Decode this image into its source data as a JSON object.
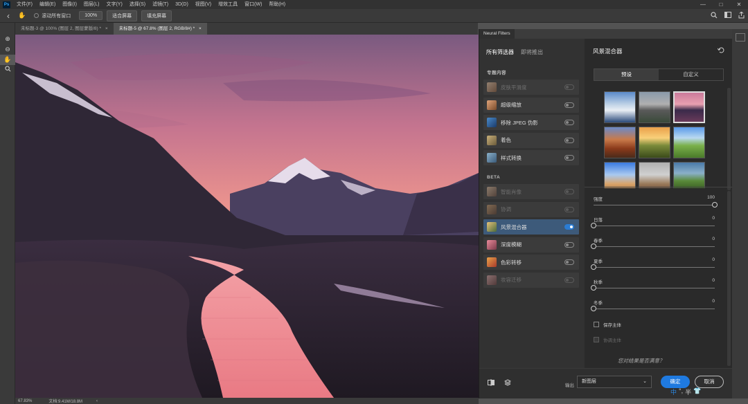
{
  "menubar": {
    "logo": "Ps",
    "items": [
      "文件(F)",
      "编辑(E)",
      "图像(I)",
      "图层(L)",
      "文字(Y)",
      "选择(S)",
      "滤镜(T)",
      "3D(D)",
      "视图(V)",
      "增效工具",
      "窗口(W)",
      "帮助(H)"
    ],
    "window_controls": [
      "—",
      "□",
      "✕"
    ]
  },
  "options": {
    "back": "‹",
    "hand": "✋",
    "scroll_all": "滚动所有窗口",
    "zoom": "100%",
    "fit_screen": "适合屏幕",
    "fill_screen": "填充屏幕"
  },
  "tabs": [
    {
      "label": "未标题-3 @ 100% (图层 2, 图层蒙版/8) *",
      "close": "×"
    },
    {
      "label": "未标题-5 @ 67.8% (图层 2, RGB/8#) *",
      "close": "×"
    }
  ],
  "status": {
    "zoom": "67.83%",
    "doc": "文档:9.41M/18.8M",
    "arrow": "‹"
  },
  "neural": {
    "panel_title": "Neural Filters",
    "left_tabs": [
      "所有筛选器",
      "即将推出"
    ],
    "section_featured": "专题内容",
    "featured": [
      {
        "label": "皮肤平滑度",
        "enabled": false,
        "dim": true
      },
      {
        "label": "超级缩放",
        "enabled": false,
        "dim": false
      },
      {
        "label": "移除 JPEG 伪影",
        "enabled": false,
        "dim": false
      },
      {
        "label": "着色",
        "enabled": false,
        "dim": false
      },
      {
        "label": "样式转换",
        "enabled": false,
        "dim": false
      }
    ],
    "section_beta": "BETA",
    "beta": [
      {
        "label": "智能肖像",
        "enabled": false,
        "dim": true
      },
      {
        "label": "协调",
        "enabled": false,
        "dim": true
      },
      {
        "label": "风景混合器",
        "enabled": true,
        "dim": false
      },
      {
        "label": "深度模糊",
        "enabled": false,
        "dim": false
      },
      {
        "label": "色彩转移",
        "enabled": false,
        "dim": false
      },
      {
        "label": "妆容迁移",
        "enabled": false,
        "dim": true
      }
    ],
    "right_title": "风景混合器",
    "segments": [
      "预设",
      "自定义"
    ],
    "sliders": [
      {
        "label": "强度",
        "value": "100",
        "pct": 100
      },
      {
        "label": "日落",
        "value": "0",
        "pct": 0
      },
      {
        "label": "春季",
        "value": "0",
        "pct": 0
      },
      {
        "label": "夏季",
        "value": "0",
        "pct": 0
      },
      {
        "label": "秋季",
        "value": "0",
        "pct": 0
      },
      {
        "label": "冬季",
        "value": "0",
        "pct": 0
      }
    ],
    "preserve_subject": "保存主体",
    "harmonize_subject": "协调主体",
    "feedback": "您对结果是否满意？",
    "output_label": "输出",
    "output_value": "新图层",
    "ok": "确定",
    "cancel": "取消"
  },
  "ime": [
    "中",
    "°,",
    "半",
    "👕"
  ]
}
